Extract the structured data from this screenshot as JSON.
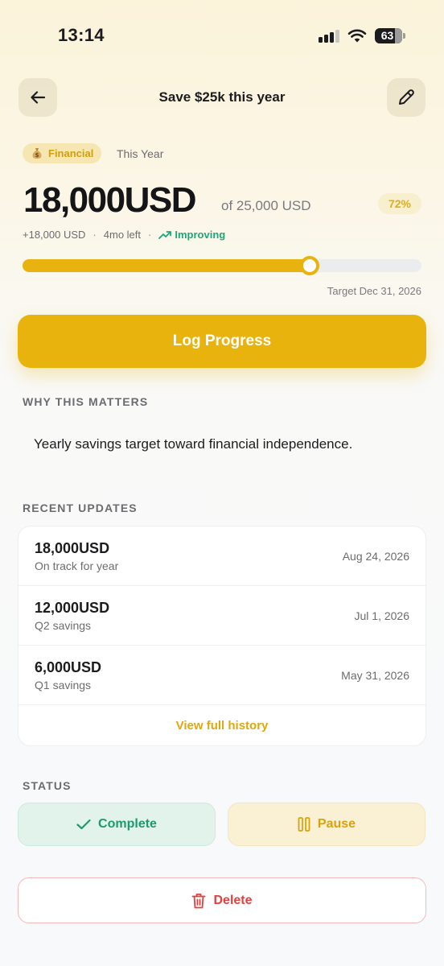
{
  "status_bar": {
    "time": "13:14",
    "battery": "63"
  },
  "header": {
    "title": "Save $25k this year",
    "back_icon": "arrow-left-icon",
    "edit_icon": "pencil-icon"
  },
  "goal": {
    "category": "Financial",
    "category_icon": "money-bag-icon",
    "period": "This Year",
    "current_amount": "18,000",
    "unit": "USD",
    "target_text": "of 25,000 USD",
    "percent_label": "72%",
    "progress": 0.72,
    "change": "+18,000 USD",
    "time_left": "4mo left",
    "trend": "Improving",
    "target_date": "Target Dec 31, 2026"
  },
  "actions": {
    "log_progress": "Log Progress"
  },
  "why": {
    "label": "WHY THIS MATTERS",
    "text": "Yearly savings target toward financial independence."
  },
  "updates": {
    "label": "RECENT UPDATES",
    "items": [
      {
        "amount": "18,000",
        "unit": "USD",
        "note": "On track for year",
        "date": "Aug 24, 2026"
      },
      {
        "amount": "12,000",
        "unit": "USD",
        "note": "Q2 savings",
        "date": "Jul 1, 2026"
      },
      {
        "amount": "6,000",
        "unit": "USD",
        "note": "Q1 savings",
        "date": "May 31, 2026"
      }
    ],
    "view_all": "View full history"
  },
  "status": {
    "label": "STATUS",
    "complete": "Complete",
    "pause": "Pause"
  },
  "danger": {
    "delete": "Delete"
  },
  "colors": {
    "accent": "#e9b30d",
    "success": "#1d9b6c",
    "danger": "#e53e3e"
  }
}
